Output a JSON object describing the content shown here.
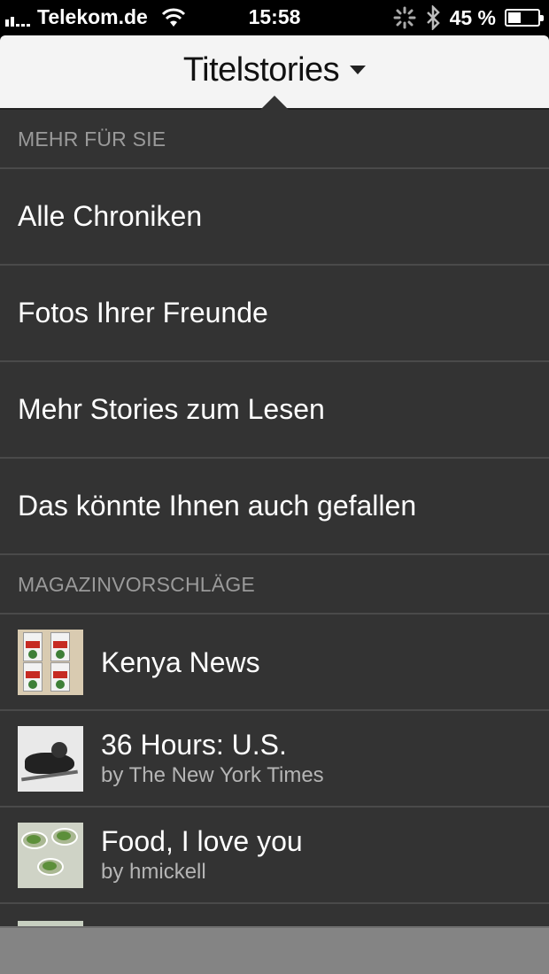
{
  "status_bar": {
    "carrier": "Telekom.de",
    "time": "15:58",
    "battery_text": "45 %",
    "battery_level": 0.45,
    "icons": [
      "signal-icon",
      "wifi-icon",
      "activity-spinner-icon",
      "bluetooth-icon",
      "battery-icon"
    ]
  },
  "header": {
    "title": "Titelstories",
    "icon": "chevron-down-icon"
  },
  "sections": {
    "more": {
      "title": "MEHR FÜR SIE",
      "items": [
        {
          "label": "Alle Chroniken"
        },
        {
          "label": "Fotos Ihrer Freunde"
        },
        {
          "label": "Mehr Stories zum Lesen"
        },
        {
          "label": "Das könnte Ihnen auch gefallen"
        }
      ]
    },
    "magazines": {
      "title": "MAGAZINVORSCHLÄGE",
      "items": [
        {
          "name": "Kenya News",
          "author": ""
        },
        {
          "name": "36 Hours: U.S.",
          "author": "by The New York Times"
        },
        {
          "name": "Food, I love you",
          "author": "by hmickell"
        }
      ]
    }
  },
  "colors": {
    "menu_bg": "#333333",
    "header_bg": "#f4f4f4",
    "divider": "#4a4a4a",
    "section_text": "#9a9a9a",
    "subtitle_text": "#b5b5b5"
  }
}
